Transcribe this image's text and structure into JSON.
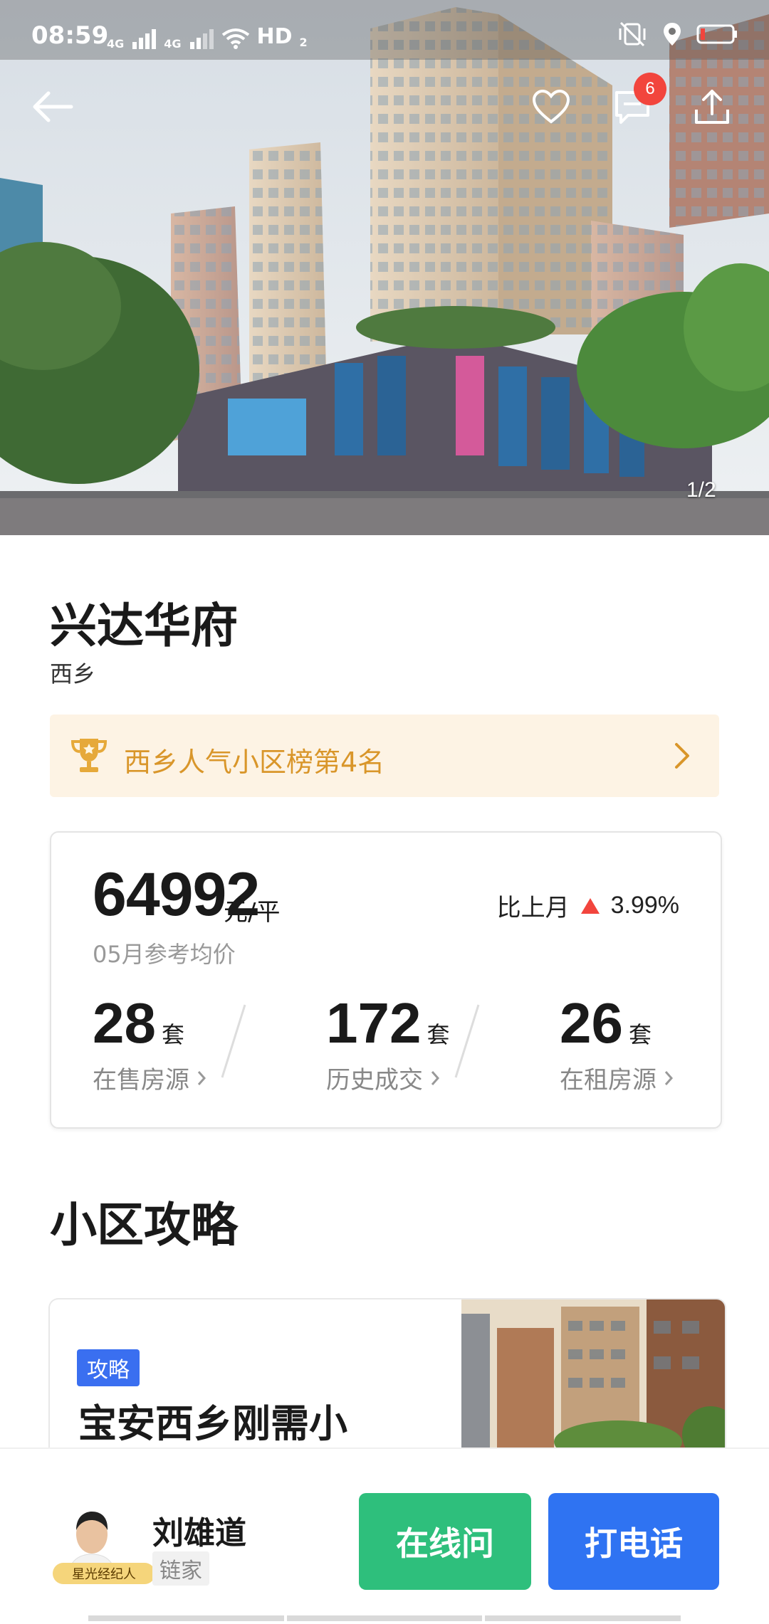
{
  "status_bar": {
    "time": "08:59",
    "network_left": "4G",
    "network_right": "4G",
    "hd_label": "HD",
    "hd_sub": "2",
    "icons": [
      "signal-icon",
      "wifi-icon",
      "vibrate-off-icon",
      "location-icon",
      "battery-low-icon"
    ]
  },
  "top_actions": {
    "message_badge": "6",
    "icons": [
      "back-arrow-icon",
      "heart-icon",
      "message-icon",
      "share-icon"
    ]
  },
  "gallery": {
    "page_indicator": "1/2"
  },
  "community": {
    "name": "兴达华府",
    "district": "西乡",
    "rank_text": "西乡人气小区榜第4名"
  },
  "price": {
    "value": "64992",
    "unit": "元/平",
    "label": "05月参考均价",
    "mom_label": "比上月",
    "mom_value": "3.99%",
    "mom_direction": "up",
    "up_color": "#f2453d"
  },
  "stats": [
    {
      "num": "28",
      "unit": "套",
      "label": "在售房源"
    },
    {
      "num": "172",
      "unit": "套",
      "label": "历史成交"
    },
    {
      "num": "26",
      "unit": "套",
      "label": "在租房源"
    }
  ],
  "guide": {
    "section_title": "小区攻略",
    "tag": "攻略",
    "article_title": "宝安西乡刚需小"
  },
  "agent": {
    "name": "刘雄道",
    "company": "链家",
    "badge": "星光经纪人",
    "online_label": "在线问",
    "call_label": "打电话",
    "online_color": "#2ebf7c",
    "call_color": "#2f73f2"
  }
}
